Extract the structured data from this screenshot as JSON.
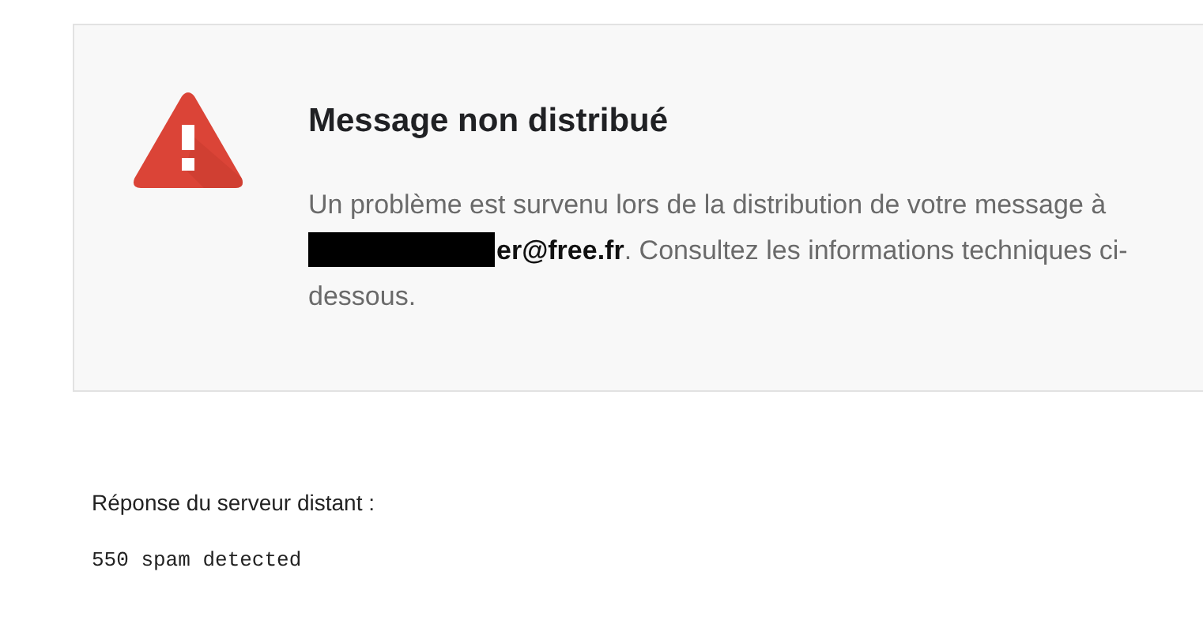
{
  "notice": {
    "title": "Message non distribué",
    "message_parts": [
      "Un problème est survenu lors de la distribution de votre message à ",
      "**er@free.fr**. Consultez les informations techniques ci-dessous."
    ]
  },
  "details": {
    "label": "Réponse du serveur distant :",
    "response": "550 spam detected"
  }
}
